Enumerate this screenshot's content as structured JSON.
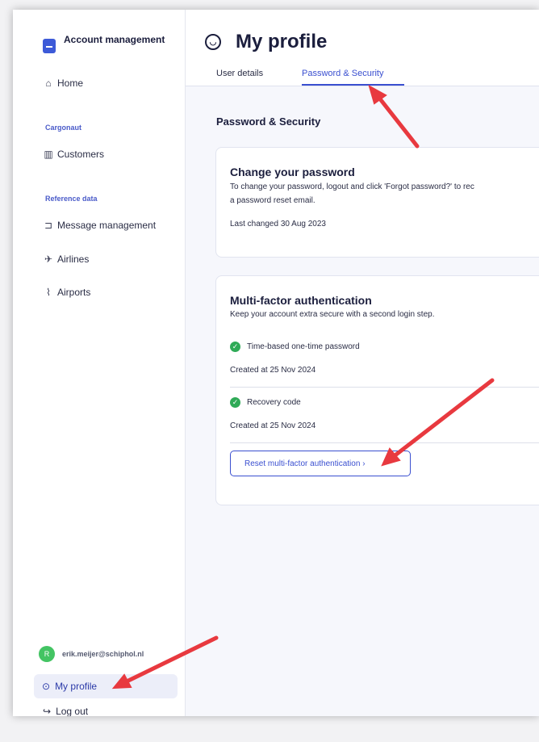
{
  "sidebar": {
    "app_title": "Account management",
    "home": "Home",
    "section_cargonaut": "Cargonaut",
    "customers": "Customers",
    "section_reference": "Reference data",
    "message_management": "Message management",
    "airlines": "Airlines",
    "airports": "Airports",
    "user_initial": "R",
    "user_email": "erik.meijer@schiphol.nl",
    "my_profile": "My profile",
    "log_out": "Log out"
  },
  "header": {
    "title": "My profile",
    "tabs": [
      "User details",
      "Password & Security"
    ],
    "active_tab": "Password & Security"
  },
  "content": {
    "section_title": "Password & Security",
    "password_card": {
      "title": "Change your password",
      "desc_line1": "To change your password, logout and click 'Forgot password?' to rec",
      "desc_line2": "a password reset email.",
      "last_changed": "Last changed 30 Aug 2023"
    },
    "mfa_card": {
      "title": "Multi-factor authentication",
      "desc": "Keep your account extra secure with a second login step.",
      "methods": [
        {
          "name": "Time-based one-time password",
          "created": "Created at 25 Nov 2024"
        },
        {
          "name": "Recovery code",
          "created": "Created at 25 Nov 2024"
        }
      ],
      "reset_button": "Reset multi-factor authentication",
      "reset_chevron": "›"
    }
  },
  "colors": {
    "accent": "#3a4fd0",
    "success": "#2faa57",
    "annotation_arrow": "#e8393f"
  }
}
